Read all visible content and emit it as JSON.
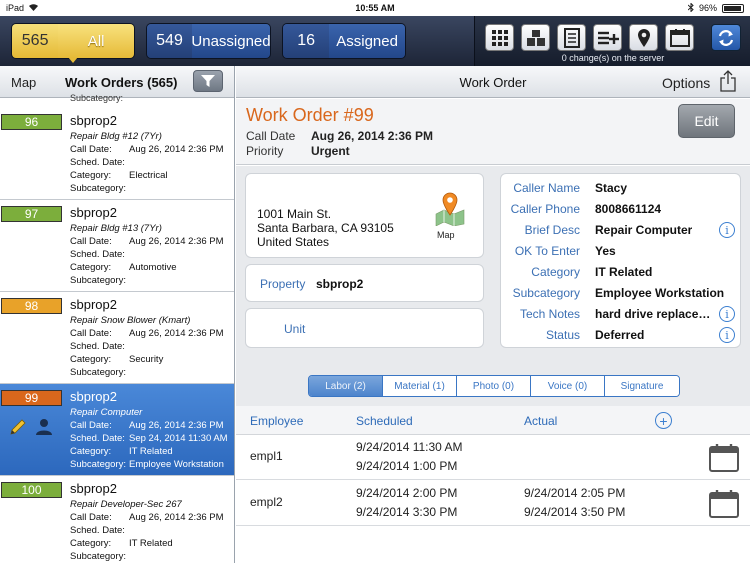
{
  "status_bar": {
    "device": "iPad",
    "time": "10:55 AM",
    "battery": "96%"
  },
  "top_bar": {
    "segments": [
      {
        "count": "565",
        "label": "All",
        "active": true
      },
      {
        "count": "549",
        "label": "Unassigned",
        "active": false
      },
      {
        "count": "16",
        "label": "Assigned",
        "active": false
      }
    ],
    "tool_icons": [
      "grid-icon",
      "boxes-icon",
      "list-icon",
      "list-add-icon",
      "location-pin-icon",
      "calendar-icon"
    ],
    "sync_icon": "sync-icon",
    "changes_text": "0 change(s) on the server"
  },
  "left_panel": {
    "map_label": "Map",
    "title": "Work Orders (565)",
    "filter_icon": "filter-icon",
    "partial_subcategory": "Subcategory:",
    "labels": {
      "call_date": "Call Date:",
      "sched_date": "Sched. Date:",
      "category": "Category:",
      "subcategory": "Subcategory:"
    },
    "items": [
      {
        "number": "96",
        "color": "#7cae3c",
        "name": "sbprop2",
        "desc": "Repair Bldg #12 (7Yr)",
        "call_date": "Aug 26, 2014 2:36 PM",
        "sched_date": "",
        "category": "Electrical",
        "subcategory": "",
        "selected": false
      },
      {
        "number": "97",
        "color": "#7cae3c",
        "name": "sbprop2",
        "desc": "Repair Bldg #13 (7Yr)",
        "call_date": "Aug 26, 2014 2:36 PM",
        "sched_date": "",
        "category": "Automotive",
        "subcategory": "",
        "selected": false
      },
      {
        "number": "98",
        "color": "#e8a229",
        "name": "sbprop2",
        "desc": "Repair Snow Blower (Kmart)",
        "call_date": "Aug 26, 2014 2:36 PM",
        "sched_date": "",
        "category": "Security",
        "subcategory": "",
        "selected": false
      },
      {
        "number": "99",
        "color": "#d9671c",
        "name": "sbprop2",
        "desc": "Repair Computer",
        "call_date": "Aug 26, 2014 2:36 PM",
        "sched_date": "Sep 24, 2014 11:30 AM",
        "category": "IT Related",
        "subcategory": "Employee Workstation",
        "selected": true
      },
      {
        "number": "100",
        "color": "#7cae3c",
        "name": "sbprop2",
        "desc": "Repair Developer-Sec 267",
        "call_date": "Aug 26, 2014 2:36 PM",
        "sched_date": "",
        "category": "IT Related",
        "subcategory": "",
        "selected": false
      }
    ]
  },
  "right_panel": {
    "title": "Work Order",
    "options_label": "Options",
    "share_icon": "share-icon",
    "wo_title": "Work Order #99",
    "call_date_label": "Call Date",
    "call_date": "Aug 26, 2014 2:36 PM",
    "priority_label": "Priority",
    "priority": "Urgent",
    "edit_label": "Edit",
    "address": {
      "line1": "1001 Main St.",
      "line2": "Santa Barbara, CA 93105",
      "line3": "United States",
      "map_label": "Map"
    },
    "property_label": "Property",
    "property_value": "sbprop2",
    "unit_label": "Unit",
    "info": [
      {
        "label": "Caller Name",
        "value": "Stacy",
        "has_info": false
      },
      {
        "label": "Caller Phone",
        "value": "8008661124",
        "has_info": false
      },
      {
        "label": "Brief Desc",
        "value": "Repair Computer",
        "has_info": true
      },
      {
        "label": "OK To Enter",
        "value": "Yes",
        "has_info": false
      },
      {
        "label": "Category",
        "value": "IT Related",
        "has_info": false
      },
      {
        "label": "Subcategory",
        "value": "Employee Workstation",
        "has_info": false
      },
      {
        "label": "Tech Notes",
        "value": "hard drive replacem...",
        "has_info": true
      },
      {
        "label": "Status",
        "value": "Deferred",
        "has_info": true
      }
    ],
    "tabs": [
      {
        "label": "Labor (2)",
        "active": true
      },
      {
        "label": "Material (1)",
        "active": false
      },
      {
        "label": "Photo (0)",
        "active": false
      },
      {
        "label": "Voice (0)",
        "active": false
      },
      {
        "label": "Signature",
        "active": false
      }
    ],
    "labor": {
      "headers": {
        "employee": "Employee",
        "scheduled": "Scheduled",
        "actual": "Actual"
      },
      "rows": [
        {
          "employee": "empl1",
          "sched_start": "9/24/2014 11:30 AM",
          "sched_end": "9/24/2014 1:00 PM",
          "actual_start": "",
          "actual_end": ""
        },
        {
          "employee": "empl2",
          "sched_start": "9/24/2014 2:00 PM",
          "sched_end": "9/24/2014 3:30 PM",
          "actual_start": "9/24/2014 2:05 PM",
          "actual_end": "9/24/2014 3:50 PM"
        }
      ]
    }
  }
}
